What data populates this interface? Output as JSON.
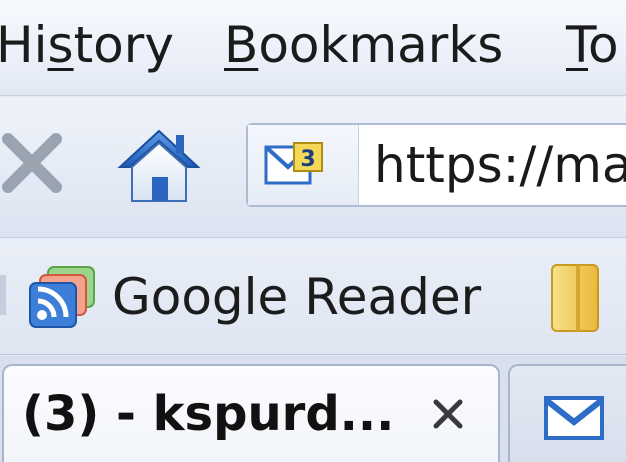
{
  "menubar": {
    "items": [
      {
        "label": "History",
        "mnemonic_index": 2
      },
      {
        "label": "Bookmarks",
        "mnemonic_index": 0
      },
      {
        "label": "To",
        "mnemonic_index": 0
      }
    ]
  },
  "navbar": {
    "icons": {
      "stop": "stop-icon",
      "home": "home-icon",
      "site": "site-identity-icon"
    },
    "url_text": "https://ma"
  },
  "bookmarks_toolbar": {
    "items": [
      {
        "label": "Google Reader",
        "icon": "google-reader-icon"
      },
      {
        "label": "",
        "icon": "folder-icon"
      }
    ]
  },
  "tabs": [
    {
      "title": "(3) - kspurd...",
      "active": true,
      "icon": "close-icon"
    },
    {
      "title": "",
      "active": false,
      "icon": "gmail-icon"
    }
  ],
  "colors": {
    "accent_blue": "#2d6cc7",
    "folder_yellow": "#f2cd4c",
    "gmail_red": "#d23a2c"
  }
}
